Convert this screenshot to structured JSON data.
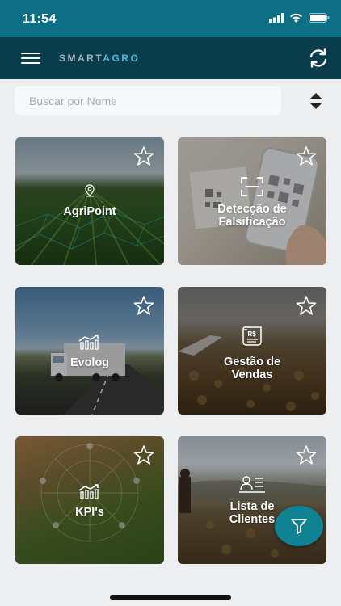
{
  "status": {
    "time": "11:54"
  },
  "header": {
    "logo_left": "SMART",
    "logo_right": "AGRO"
  },
  "search": {
    "placeholder": "Buscar por Nome"
  },
  "cards": [
    {
      "title": "AgriPoint",
      "icon": "map-pin-icon"
    },
    {
      "title_line1": "Detecção de",
      "title_line2": "Falsificação",
      "icon": "scan-icon"
    },
    {
      "title": "Evolog",
      "icon": "chart-bar-icon"
    },
    {
      "title_line1": "Gestão de",
      "title_line2": "Vendas",
      "icon": "receipt-icon"
    },
    {
      "title": "KPI's",
      "icon": "chart-bar-icon"
    },
    {
      "title_line1": "Lista de",
      "title_line2": "Clientes",
      "icon": "contact-card-icon"
    }
  ],
  "colors": {
    "statusbar": "#0e6f84",
    "appbar": "#0a3d4c",
    "fab": "#0e8394",
    "background": "#eceef0"
  }
}
